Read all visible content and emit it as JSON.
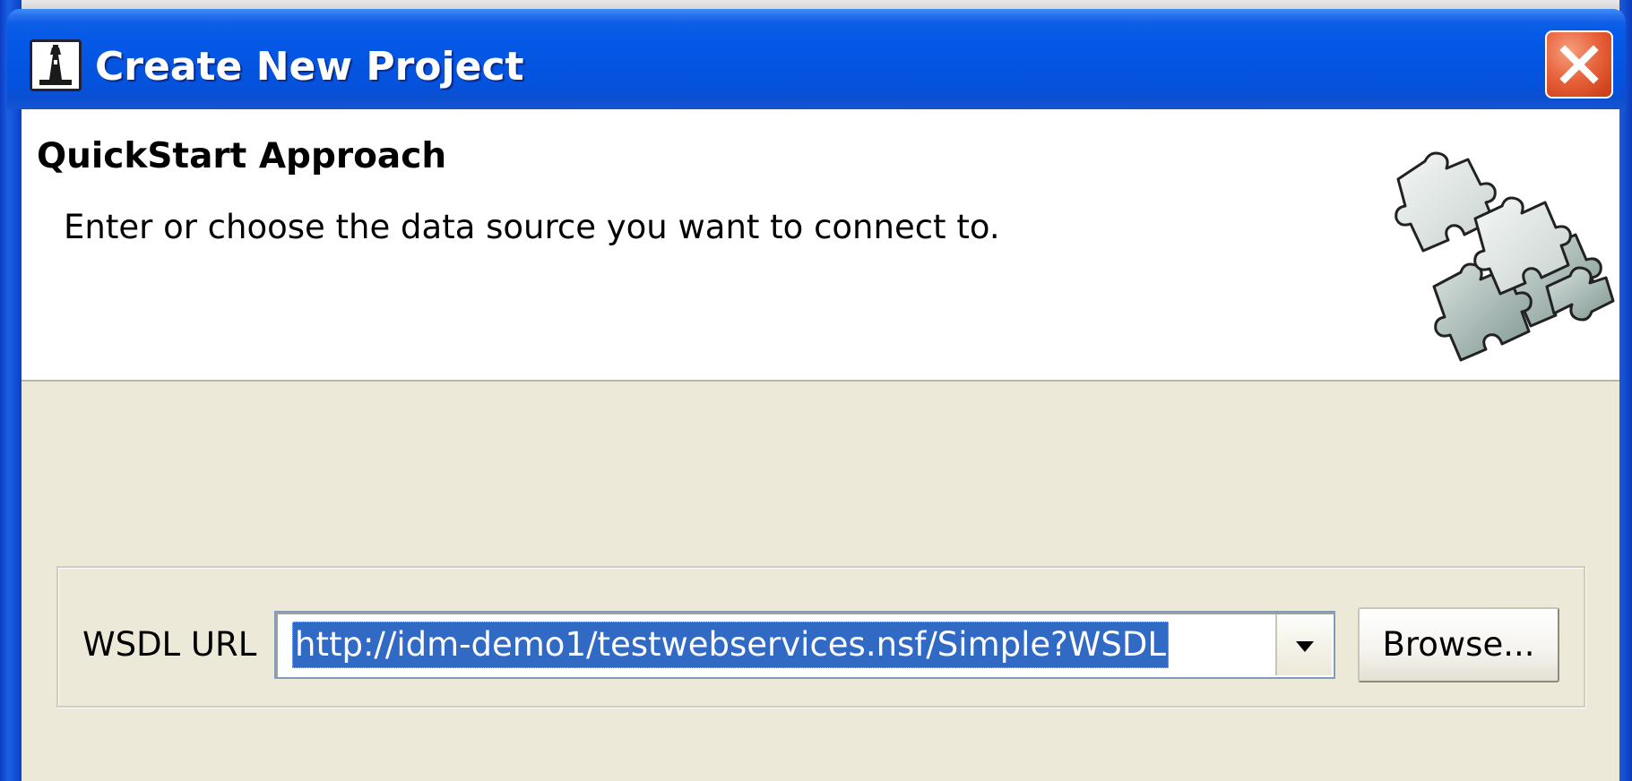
{
  "window": {
    "title": "Create New Project",
    "app_icon": "lighthouse-app-icon",
    "close_icon": "close-icon"
  },
  "header": {
    "title": "QuickStart Approach",
    "description": "Enter or choose the data source you want to connect to.",
    "graphic": "puzzle-pieces-icon"
  },
  "form": {
    "wsdl_label": "WSDL URL",
    "wsdl_value": "http://idm-demo1/testwebservices.nsf/Simple?WSDL",
    "dropdown_icon": "chevron-down-icon",
    "browse_label": "Browse..."
  },
  "colors": {
    "titlebar": "#0559e6",
    "close_button": "#e8653e",
    "selection": "#316ac5",
    "dialog_background": "#ece9d8"
  }
}
